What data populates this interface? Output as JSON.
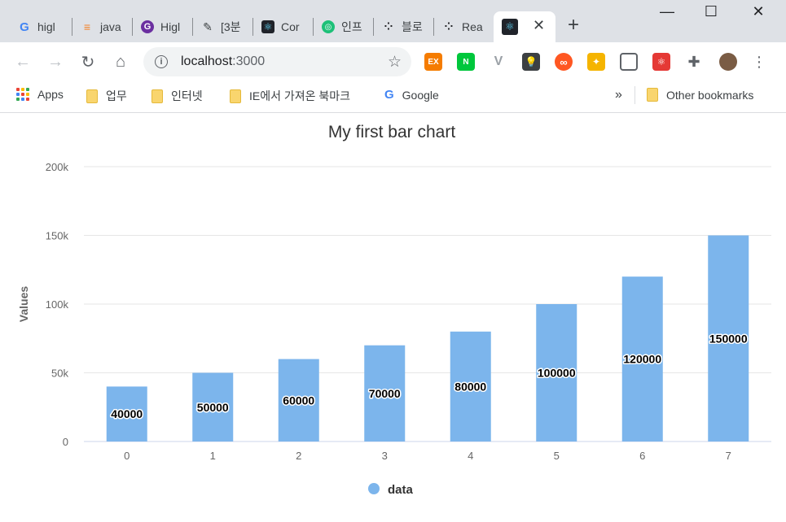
{
  "browser": {
    "tabs": [
      {
        "label": "higl",
        "icon": "google-icon"
      },
      {
        "label": "java",
        "icon": "stackoverflow-icon"
      },
      {
        "label": "Higl",
        "icon": "g-logo-icon"
      },
      {
        "label": "[3분",
        "icon": "pen-icon"
      },
      {
        "label": "Cor",
        "icon": "react-icon"
      },
      {
        "label": "인프",
        "icon": "inflearn-icon"
      },
      {
        "label": "블로",
        "icon": "dots-icon"
      },
      {
        "label": "Rea",
        "icon": "dots-icon"
      },
      {
        "label": "",
        "icon": "react-icon",
        "active": true
      }
    ],
    "url_host": "localhost",
    "url_port": ":3000",
    "bookmarks": [
      {
        "label": "Apps",
        "icon": "apps-icon"
      },
      {
        "label": "업무",
        "icon": "folder-icon"
      },
      {
        "label": "인터넷",
        "icon": "folder-icon"
      },
      {
        "label": "IE에서 가져온 북마크",
        "icon": "folder-icon"
      },
      {
        "label": "Google",
        "icon": "google-icon"
      }
    ],
    "overflow_label": "»",
    "other_bookmarks": "Other bookmarks",
    "extensions": [
      {
        "label": "EX",
        "icon": "ex-icon",
        "color": "#f57c00"
      },
      {
        "label": "N",
        "icon": "naver-icon",
        "color": "#00c73c"
      },
      {
        "label": "V",
        "icon": "vue-icon",
        "color": "#9aa0a6"
      },
      {
        "label": "",
        "icon": "bulb-icon",
        "color": "#3c4043"
      },
      {
        "label": "∞",
        "icon": "infinity-icon",
        "color": "#ff5722"
      },
      {
        "label": "",
        "icon": "color-picker-icon",
        "color": "#f5b400"
      },
      {
        "label": "",
        "icon": "window-icon",
        "color": "#5f6368"
      },
      {
        "label": "",
        "icon": "react-devtools-icon",
        "color": "#e53935"
      },
      {
        "label": "",
        "icon": "puzzle-icon",
        "color": "#5f6368"
      },
      {
        "label": "",
        "icon": "avatar-icon",
        "color": "#7a5c44"
      }
    ]
  },
  "chart_data": {
    "type": "bar",
    "title": "My first bar chart",
    "xlabel": "",
    "ylabel": "Values",
    "categories": [
      "0",
      "1",
      "2",
      "3",
      "4",
      "5",
      "6",
      "7"
    ],
    "series": [
      {
        "name": "data",
        "values": [
          40000,
          50000,
          60000,
          70000,
          80000,
          100000,
          120000,
          150000
        ],
        "color": "#7cb5ec"
      }
    ],
    "ylim": [
      0,
      200000
    ],
    "yticks": [
      {
        "value": 0,
        "label": "0"
      },
      {
        "value": 50000,
        "label": "50k"
      },
      {
        "value": 100000,
        "label": "100k"
      },
      {
        "value": 150000,
        "label": "150k"
      },
      {
        "value": 200000,
        "label": "200k"
      }
    ],
    "data_labels": true,
    "grid": true,
    "legend_position": "bottom-center"
  }
}
